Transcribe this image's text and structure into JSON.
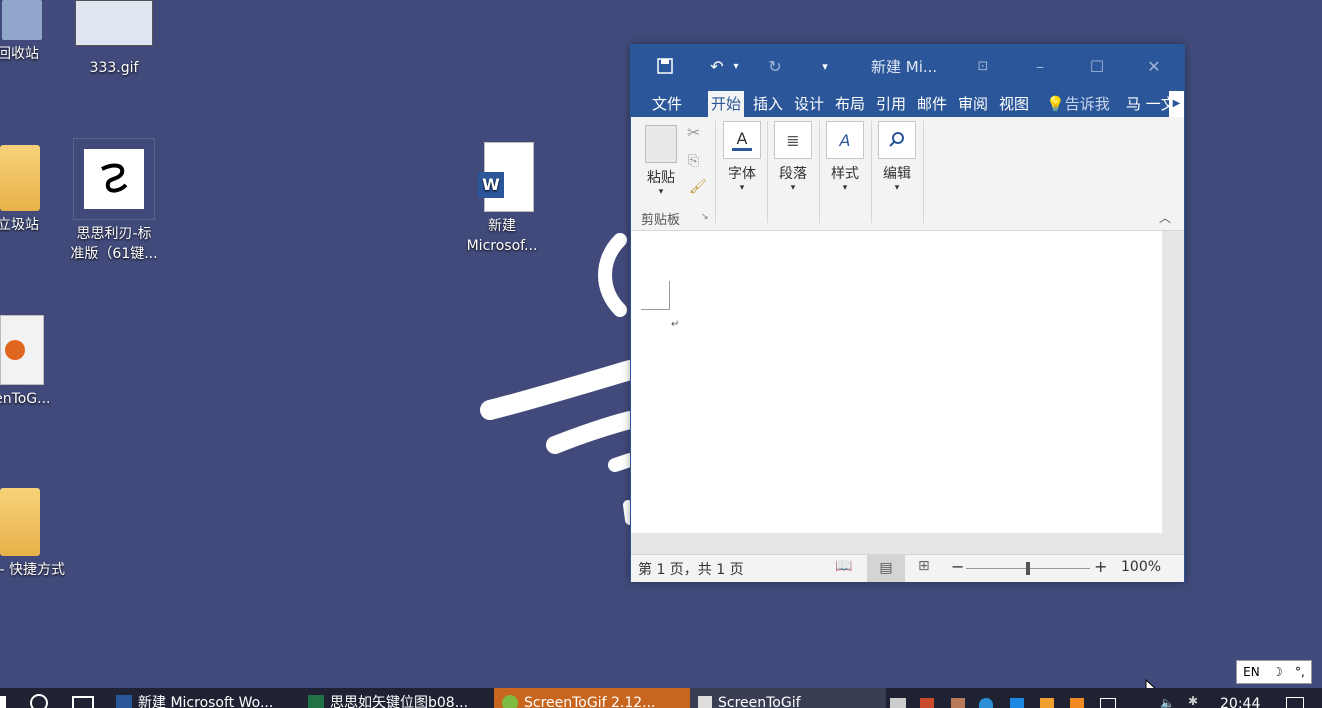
{
  "desktop": {
    "icons": [
      {
        "label": "回收站"
      },
      {
        "label": "333.gif"
      },
      {
        "label": "立圾站"
      },
      {
        "label": "思思利刃-标准版（61键..."
      },
      {
        "label": "新建 Microsof..."
      },
      {
        "label": "eenToG..."
      },
      {
        "label": "三 - 快捷方式"
      }
    ]
  },
  "word": {
    "title": "新建 Mi...",
    "tabs": [
      "文件",
      "开始",
      "插入",
      "设计",
      "布局",
      "引用",
      "邮件",
      "审阅",
      "视图"
    ],
    "tell_me": "告诉我",
    "user": "马 一文",
    "ribbon": {
      "paste": "粘贴",
      "font": "字体",
      "paragraph": "段落",
      "styles": "样式",
      "editing": "编辑",
      "clipboard_group": "剪贴板"
    },
    "status": {
      "page_info": "第 1 页，共 1 页",
      "zoom": "100%",
      "zoom_level": 1.0
    }
  },
  "taskbar": {
    "items": [
      {
        "label": "新建 Microsoft Wo..."
      },
      {
        "label": "思思如矢键位图b08..."
      },
      {
        "label": "ScreenToGif 2.12..."
      },
      {
        "label": "ScreenToGif"
      }
    ],
    "clock": "20:44"
  },
  "language": {
    "code": "EN",
    "moon": "☽",
    "punct": "°,"
  },
  "colors": {
    "desktop_bg": "#414a7a",
    "word_blue": "#2b579a",
    "taskbar_active": "#c8651e"
  }
}
